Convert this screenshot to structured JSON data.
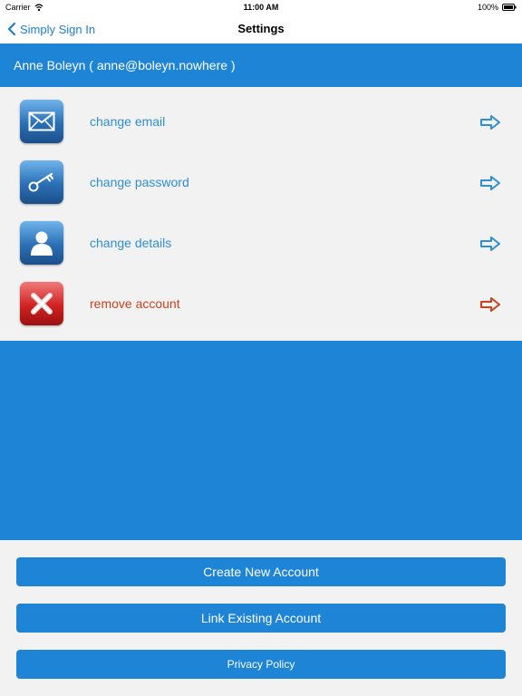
{
  "status_bar": {
    "carrier": "Carrier",
    "time": "11:00 AM",
    "battery": "100%"
  },
  "nav": {
    "back_label": "Simply Sign In",
    "title": "Settings"
  },
  "user": {
    "header": "Anne Boleyn ( anne@boleyn.nowhere )"
  },
  "menu": {
    "items": [
      {
        "label": "change email",
        "icon": "envelope-icon"
      },
      {
        "label": "change password",
        "icon": "key-icon"
      },
      {
        "label": "change details",
        "icon": "person-icon"
      },
      {
        "label": "remove account",
        "icon": "close-icon"
      }
    ]
  },
  "buttons": {
    "create": "Create New Account",
    "link": "Link Existing Account",
    "privacy": "Privacy Policy"
  },
  "colors": {
    "accent": "#1d84d6",
    "link": "#2f8fd3",
    "danger": "#c9431f",
    "background": "#f2f2f2"
  }
}
